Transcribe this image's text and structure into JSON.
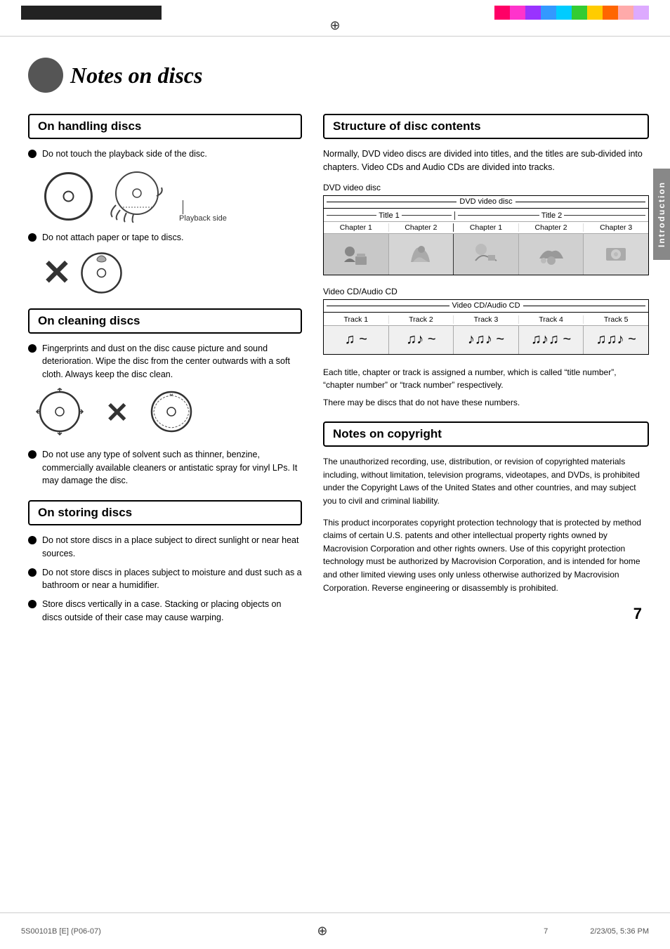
{
  "page": {
    "title": "Notes on discs",
    "page_number": "7",
    "footer_left": "5S00101B [E] (P06-07)",
    "footer_center": "7",
    "footer_right": "2/23/05, 5:36 PM"
  },
  "top_colors": [
    "#ff0066",
    "#ff33cc",
    "#9933ff",
    "#3399ff",
    "#00ccff",
    "#33cc33",
    "#ffcc00",
    "#ff6600",
    "#ff9999",
    "#cc99ff"
  ],
  "sections": {
    "handling": {
      "title": "On handling discs",
      "bullet1": "Do not touch the playback side of the disc.",
      "playback_label": "Playback side",
      "bullet2": "Do not attach paper or tape to discs."
    },
    "cleaning": {
      "title": "On cleaning discs",
      "bullet1": "Fingerprints and dust on the disc cause picture and sound deterioration. Wipe the disc from the center outwards with a soft cloth. Always keep the disc clean.",
      "bullet2": "Do not use any type of solvent such as thinner, benzine, commercially available cleaners or antistatic spray for vinyl LPs. It may damage the disc."
    },
    "storing": {
      "title": "On storing discs",
      "bullet1": "Do not store discs in a place subject to direct sunlight or near heat sources.",
      "bullet2": "Do not store discs in places subject to moisture and dust such as a bathroom or near a humidifier.",
      "bullet3": "Store discs vertically in a case. Stacking or placing objects on discs outside of their case may cause warping."
    },
    "structure": {
      "title": "Structure of disc contents",
      "description": "Normally, DVD video discs are divided into titles, and the titles are sub-divided into chapters. Video CDs and Audio CDs are divided into tracks.",
      "dvd_label": "DVD video disc",
      "dvd_diagram": {
        "header": "DVD video disc",
        "title1": "Title 1",
        "title2": "Title 2",
        "chapters": [
          "Chapter 1",
          "Chapter 2",
          "Chapter 1",
          "Chapter 2",
          "Chapter 3"
        ]
      },
      "vcd_label": "Video CD/Audio CD",
      "vcd_diagram": {
        "header": "Video CD/Audio CD",
        "tracks": [
          "Track 1",
          "Track 2",
          "Track 3",
          "Track 4",
          "Track 5"
        ]
      },
      "description2": "Each title, chapter or track is assigned a number, which is called “title number”, “chapter number” or “track number” respectively.",
      "description3": "There may be discs that do not have these numbers."
    },
    "copyright": {
      "title": "Notes on copyright",
      "para1": "The unauthorized recording, use, distribution, or revision of copyrighted materials including, without limitation, television programs, videotapes, and DVDs, is prohibited under the Copyright Laws of the United States and other countries, and may subject you to civil and criminal liability.",
      "para2": "This product incorporates copyright protection technology that is protected by method claims of certain U.S. patents and other intellectual property rights owned by Macrovision Corporation and other rights owners. Use of this copyright protection technology must be authorized by Macrovision Corporation, and is intended for home and other limited viewing uses only unless otherwise authorized by Macrovision Corporation. Reverse engineering or disassembly is prohibited."
    }
  },
  "sidebar": {
    "label": "Introduction"
  }
}
